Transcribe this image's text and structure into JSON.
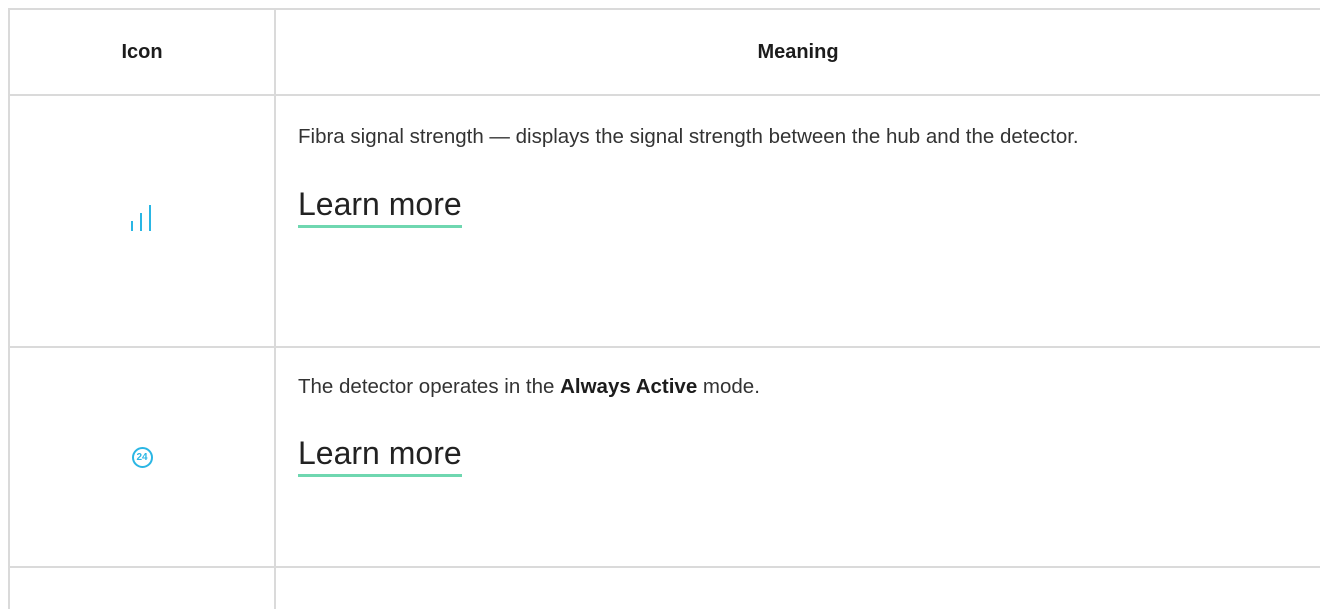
{
  "table": {
    "headers": {
      "icon": "Icon",
      "meaning": "Meaning"
    },
    "rows": [
      {
        "icon": "signal-strength-icon",
        "description": "Fibra signal strength — displays the signal strength between the hub and the detector.",
        "link": "Learn more"
      },
      {
        "icon": "always-active-icon",
        "icon_text": "24",
        "description_pre": "The detector operates in the ",
        "description_bold": "Always Active",
        "description_post": " mode.",
        "link": "Learn more"
      }
    ]
  },
  "colors": {
    "accent_icon": "#2ab6e4",
    "link_underline": "#6fd7b0",
    "border": "#dadada"
  }
}
